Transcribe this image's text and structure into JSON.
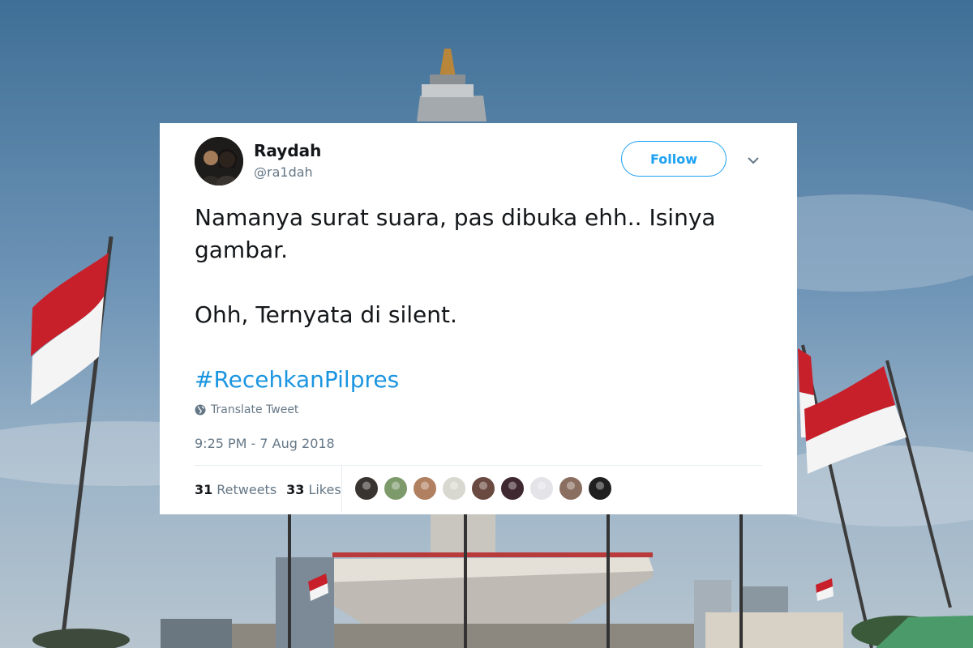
{
  "tweet": {
    "author_name": "Raydah",
    "author_handle": "@ra1dah",
    "follow_label": "Follow",
    "text_line1": "Namanya surat suara, pas dibuka ehh.. Isinya gambar.",
    "text_line2": "Ohh, Ternyata di silent.",
    "hashtag": "#RecehkanPilpres",
    "translate_label": "Translate Tweet",
    "timestamp": "9:25 PM - 7 Aug 2018",
    "retweets_count": "31",
    "retweets_label": "Retweets",
    "likes_count": "33",
    "likes_label": "Likes"
  },
  "likers": [
    {
      "color": "#3a3430"
    },
    {
      "color": "#7d9a6a"
    },
    {
      "color": "#b08060"
    },
    {
      "color": "#d8d8d0"
    },
    {
      "color": "#6a4a40"
    },
    {
      "color": "#402830"
    },
    {
      "color": "#e4e4e8"
    },
    {
      "color": "#8a6e60"
    },
    {
      "color": "#202020"
    }
  ],
  "colors": {
    "accent": "#1da1f2",
    "hashtag": "#1b95e0",
    "muted": "#657786",
    "text": "#14171a"
  }
}
